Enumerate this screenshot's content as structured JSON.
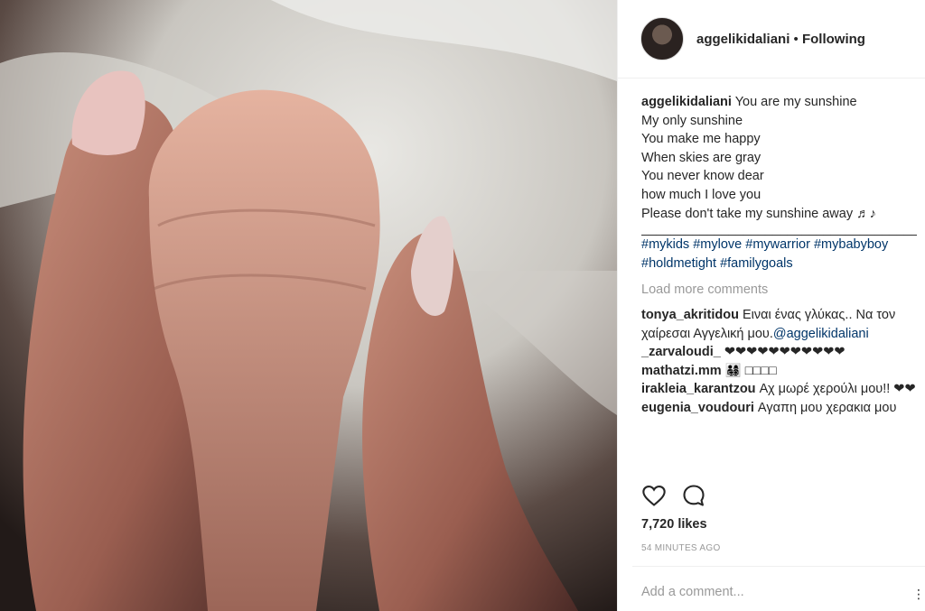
{
  "post": {
    "username": "aggelikidaliani",
    "separator": " • ",
    "follow_status": "Following",
    "caption_user": "aggelikidaliani",
    "caption_lines": [
      " You are my sunshine",
      "My only sunshine",
      "You make me happy",
      "When skies are gray",
      "You never know dear",
      "how much I love you",
      "Please don't take my sunshine away ♬♪",
      "_______________________________________"
    ],
    "hashtags_line1": [
      "#mykids",
      "#mylove",
      "#mywarrior",
      "#mybaby​boy"
    ],
    "hashtags_line2": [
      "#holdmetight",
      "#familygoals"
    ],
    "load_more": "Load more comments",
    "comments": [
      {
        "user": "tonya_akritidou",
        "text": " Ειναι ένας γλύκας.. Να τον χαίρεσαι Αγγελική μου.",
        "mention": "@aggelikidaliani"
      },
      {
        "user": "_zarvaloudi_",
        "text": " ❤❤❤❤❤❤❤❤❤❤❤"
      },
      {
        "user": "mathatzi.mm",
        "text": " 👨‍👩‍👧‍👦 □□□□"
      },
      {
        "user": "irakleia_karantzou",
        "text": " Αχ μωρέ χερούλι μου!! ❤❤"
      },
      {
        "user": "eugenia_voudouri",
        "text": " Αγαπη μου χερακια μου"
      }
    ],
    "likes": "7,720 likes",
    "time_ago": "54 MINUTES AGO",
    "add_comment_placeholder": "Add a comment...",
    "more_label": "..."
  },
  "icons": {
    "like": "heart-icon",
    "comment": "comment-bubble-icon"
  },
  "colors": {
    "link": "#003569",
    "muted": "#999999",
    "text": "#262626"
  }
}
